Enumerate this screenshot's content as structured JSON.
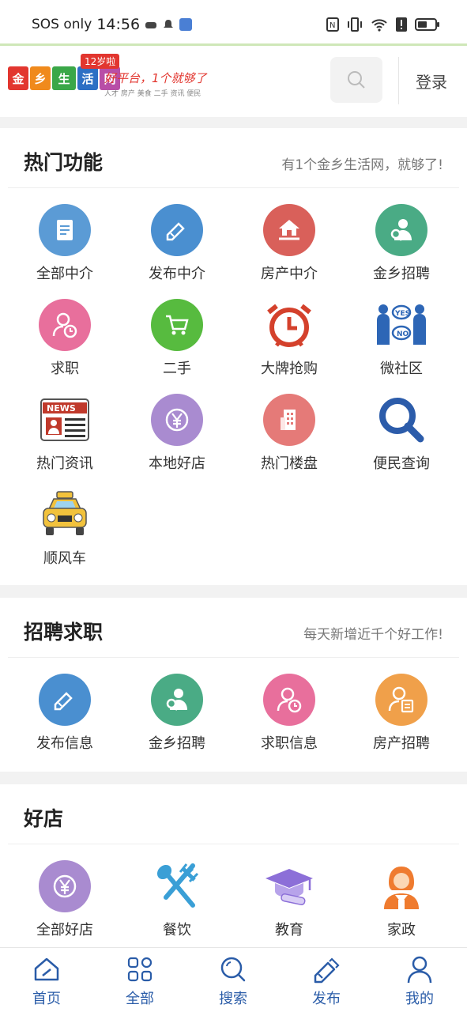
{
  "status_bar": {
    "carrier": "SOS only",
    "time": "14:56"
  },
  "header": {
    "logo_text": [
      "金",
      "乡",
      "生",
      "活",
      "网"
    ],
    "logo_age": "12岁啦",
    "logo_slogan": "好平台，1个就够了",
    "logo_tags": "人才 房产 美食 二手 资讯 便民",
    "login_label": "登录"
  },
  "hot": {
    "title": "热门功能",
    "subtitle": "有1个金乡生活网，就够了!",
    "items": [
      {
        "label": "全部中介",
        "icon": "document-icon",
        "color": "#5b9bd5"
      },
      {
        "label": "发布中介",
        "icon": "edit-tag-icon",
        "color": "#4a8fd0"
      },
      {
        "label": "房产中介",
        "icon": "house-hand-icon",
        "color": "#d9605a"
      },
      {
        "label": "金乡招聘",
        "icon": "recruit-person-icon",
        "color": "#4aab85"
      },
      {
        "label": "求职",
        "icon": "person-clock-icon",
        "color": "#e86f9c"
      },
      {
        "label": "二手",
        "icon": "cart-icon",
        "color": "#57bb3f"
      },
      {
        "label": "大牌抢购",
        "icon": "alarm-clock-icon",
        "color": "#d4412c"
      },
      {
        "label": "微社区",
        "icon": "community-icon",
        "color": "#2d66b6"
      },
      {
        "label": "热门资讯",
        "icon": "news-icon",
        "color": "#c0392b"
      },
      {
        "label": "本地好店",
        "icon": "yen-icon",
        "color": "#a98bd0"
      },
      {
        "label": "热门楼盘",
        "icon": "building-icon",
        "color": "#e57a78"
      },
      {
        "label": "便民查询",
        "icon": "magnifier-icon",
        "color": "#2c5caa"
      },
      {
        "label": "顺风车",
        "icon": "taxi-icon",
        "color": "#f2c23c"
      }
    ]
  },
  "jobs": {
    "title": "招聘求职",
    "subtitle": "每天新增近千个好工作!",
    "items": [
      {
        "label": "发布信息",
        "icon": "edit-tag-icon",
        "color": "#4a8fd0"
      },
      {
        "label": "金乡招聘",
        "icon": "recruit-person-icon",
        "color": "#4aab85"
      },
      {
        "label": "求职信息",
        "icon": "person-clock-icon",
        "color": "#e86f9c"
      },
      {
        "label": "房产招聘",
        "icon": "person-resume-icon",
        "color": "#f0a04a"
      }
    ]
  },
  "shops": {
    "title": "好店",
    "items": [
      {
        "label": "全部好店",
        "icon": "yen-icon",
        "color": "#a98bd0"
      },
      {
        "label": "餐饮",
        "icon": "fork-spoon-icon",
        "color": "#3a9fd6"
      },
      {
        "label": "教育",
        "icon": "graduation-cap-icon",
        "color": "#8c6fd8"
      },
      {
        "label": "家政",
        "icon": "housekeeper-icon",
        "color": "#ef7b2f"
      }
    ]
  },
  "bottom_nav": [
    {
      "label": "首页",
      "icon": "home-icon"
    },
    {
      "label": "全部",
      "icon": "grid-icon"
    },
    {
      "label": "搜索",
      "icon": "search-icon"
    },
    {
      "label": "发布",
      "icon": "publish-icon"
    },
    {
      "label": "我的",
      "icon": "user-icon"
    }
  ]
}
